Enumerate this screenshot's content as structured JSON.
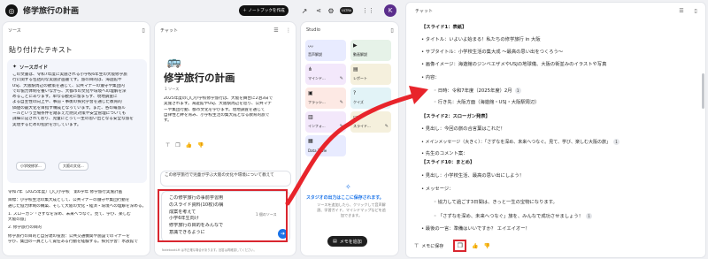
{
  "app": {
    "title": "修学旅行の計画",
    "create_notebook_label": "＋ ノートブックを作成",
    "ultra_badge": "ULTRA",
    "avatar_letter": "K"
  },
  "sources": {
    "header": "ソース",
    "title": "貼り付けたテキスト",
    "guide_title": "ソースガイド",
    "guide_text": [
      "この文書は、令和7年度に実施される小学校6年生の大阪修学旅",
      "行に関する包括的な実施計画書です。旅の目的は、海遊館や",
      "USJ、大阪駅周辺の散策を通じて、公共マナーの遵守や集団内",
      "での協力体制を養いながら、大都市の文化や環境への理解を深",
      "めることにあります。単なる観光に留まらず、現地調査に",
      "よる自主性の向上や、事前・事後の探究学習を通じた教育的",
      "価値の最大化を目指す構成となっています。また、各の毎旅ル",
      "ールという立場条件を踏まえた防災対策や安全管理についても",
      "詳細に記されており、児童にとって一生の思い出となる安全な旅を",
      "実現するための指針を示しています。"
    ],
    "topic_chips": [
      "小学校修学...",
      "大阪の文化..."
    ],
    "body": [
      "令和7年（2025年度）〇〇小学校　第6学年 修学旅行実施計画",
      "",
      "目標：小学校生活の集大成として、公共マナーの遵守や集団行動を",
      "通じた協力体制の構築、そして大阪の文化・経済・環境への理解を深める。",
      "",
      "1. スローガン「さずなを深め、未来へつなぐ。見て、学び、楽しむ",
      "大阪の旅」",
      "",
      "2. 修学旅行の目的",
      "",
      "修学旅行の目的と自分達の役割：公共交通機関や施設でのマナーを",
      "学び、集団の一員として責任ある行動を経験する。探究学習：水族館で"
    ]
  },
  "chat": {
    "header": "チャット",
    "title": "修学旅行の計画",
    "source_count": "1 ソース",
    "summary": [
      "2025年度の〇〇小学校修学旅行は、大阪を舞台に2泊3日で",
      "実施されます。海遊館やUSJ、大阪駅周辺を巡り、公共マナ",
      "ーや集団行動、都市文化を学びます。現地調査を通じて",
      "自律性と絆を育み、小学校生活の集大成となる教育的旅で",
      "す。"
    ],
    "prompt_placeholder": "この修学旅行で児童が学ぶ大阪の文化や環境について教えて",
    "input_lines": [
      "この修学旅行の事前学習用",
      "のスライド資料(10枚)の構",
      "成案を考えて",
      "小学6年生向け",
      "修学旅行の目的をみんなで",
      "意識できるように"
    ],
    "input_source_count": "1 個のソース",
    "footer": "NotebookLM は不正確な場合があります。回答は再確認してください。"
  },
  "studio": {
    "header": "Studio",
    "tiles": [
      {
        "label": "音声解説",
        "icon": "audio-icon",
        "color": "#e8ebff"
      },
      {
        "label": "動画解説",
        "icon": "video-icon",
        "color": "#e6f2e8"
      },
      {
        "label": "マインド...",
        "icon": "mindmap-icon",
        "color": "#f3e8fb"
      },
      {
        "label": "レポート",
        "icon": "report-icon",
        "color": "#f5f0dd"
      },
      {
        "label": "フラッシ...",
        "icon": "flashcard-icon",
        "color": "#fde9e4"
      },
      {
        "label": "クイズ",
        "icon": "quiz-icon",
        "color": "#e2f3f7"
      },
      {
        "label": "インフォ...",
        "icon": "infographic-icon",
        "color": "#f3e8fb"
      },
      {
        "label": "スライド...",
        "icon": "slides-icon",
        "color": "#f5f0dd"
      },
      {
        "label": "Data Table",
        "icon": "table-icon",
        "color": "#e8ebff"
      }
    ],
    "empty_title": "スタジオの出力はここに保存されます。",
    "empty_text": [
      "ソースを追加したら、クリックして音声解",
      "説、学習ガイド、マインドマップなどを追",
      "加できます。"
    ],
    "add_note_label": "メモを追加"
  },
  "right_chat": {
    "header": "チャット",
    "save_label": "メモに保存",
    "lines": [
      {
        "text": "【スライド1：表紙】",
        "bold": true,
        "indent": 0
      },
      {
        "text": "• タイトル：いよいよ始まる！私たちの修学旅行 in 大阪",
        "bold": false,
        "indent": 0
      },
      {
        "text": "• サブタイトル：小学校生活の集大成 ～最高の思い出をつくろう～",
        "bold": false,
        "indent": 0
      },
      {
        "text": "• 画像イメージ：海遊館のジンベエザメやUSJの地球儀、大阪の街並みのイラストや写真",
        "bold": false,
        "indent": 0
      },
      {
        "text": "• 内容：",
        "bold": false,
        "indent": 0
      },
      {
        "text": "◦ 日時：令和7年度（2025年度）2月",
        "bold": false,
        "indent": 1,
        "cite": "1"
      },
      {
        "text": "◦ 行き先：大阪方面（海遊館・USJ・大阪駅周辺）",
        "bold": false,
        "indent": 1
      },
      {
        "text": "【スライド2：スローガン発表】",
        "bold": true,
        "indent": 0
      },
      {
        "text": "• 見出し：今回の旅の合言葉はこれだ！",
        "bold": false,
        "indent": 0
      },
      {
        "text": "• メインメッセージ（大きく）：「さずなを深め、未来へつなぐ。見て、学び、楽しむ大阪の旅」",
        "bold": false,
        "indent": 0,
        "cite": "1"
      },
      {
        "text": "• 先生のコメント案：",
        "bold": false,
        "indent": 0
      },
      {
        "text": "【スライド10：まとめ】",
        "bold": true,
        "indent": 0
      },
      {
        "text": "• 見出し：小学校生活、最高の思い出にしよう！",
        "bold": false,
        "indent": 0
      },
      {
        "text": "• メッセージ：",
        "bold": false,
        "indent": 0
      },
      {
        "text": "◦ 協力して過ごす3日間は、きっと一生の宝物になります。",
        "bold": false,
        "indent": 1
      },
      {
        "text": "◦ 「さずなを深め、未来へつなぐ」旅を、みんなで成功させましょう！",
        "bold": false,
        "indent": 1,
        "cite": "1"
      },
      {
        "text": "• 最後の一言：準備はいいですか？ エイエイオー！",
        "bold": false,
        "indent": 0
      }
    ]
  },
  "colors": {
    "accent_red": "#e8242b",
    "highlight_box": "#d9262f",
    "brand_blue": "#1a73e8",
    "dark_button": "#1f1f1f"
  }
}
